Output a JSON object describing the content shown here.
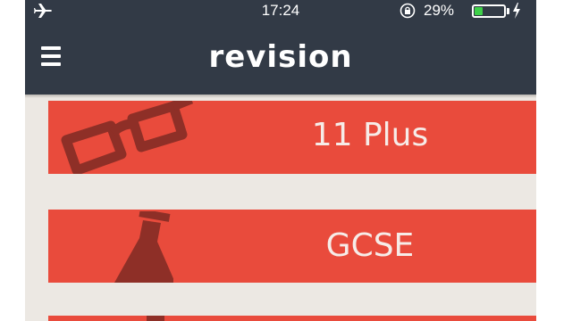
{
  "status_bar": {
    "time": "17:24",
    "battery_percent_text": "29%",
    "battery_level": 0.29,
    "icons": [
      "airplane-icon",
      "orientation-lock-icon",
      "battery-icon",
      "charging-bolt-icon"
    ]
  },
  "navbar": {
    "title": "revision",
    "menu_icon": "hamburger-menu-icon"
  },
  "categories": [
    {
      "label": "11 Plus",
      "icon": "glasses-icon"
    },
    {
      "label": "GCSE",
      "icon": "flask-icon"
    },
    {
      "label": "",
      "icon": "unknown-icon"
    }
  ],
  "colors": {
    "bar": "#323a46",
    "card": "#e94b3c",
    "card_art": "#8e2f27",
    "background": "#ece8e3",
    "battery_fill": "#3fd14a"
  }
}
